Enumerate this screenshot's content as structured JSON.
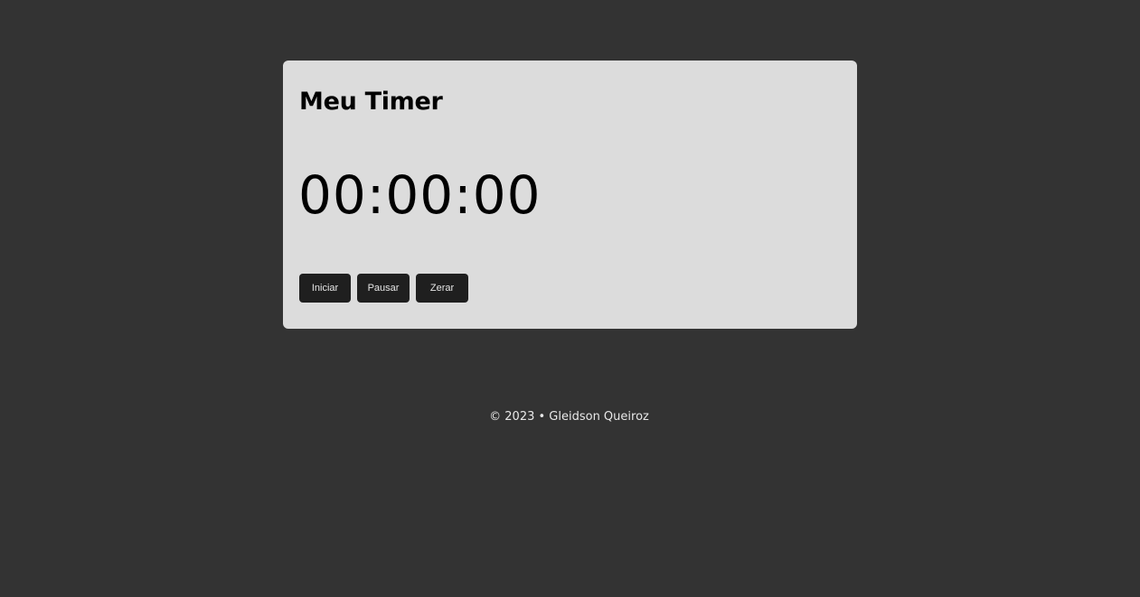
{
  "timer": {
    "title": "Meu Timer",
    "display": "00:00:00",
    "buttons": {
      "start": "Iniciar",
      "pause": "Pausar",
      "reset": "Zerar"
    }
  },
  "footer": {
    "text": "© 2023 • Gleidson Queiroz"
  },
  "colors": {
    "page_background": "#333333",
    "card_background": "#dcdcdc",
    "button_background": "#1f1f1f",
    "button_text": "#e6e6e6",
    "footer_text": "#e8e8e8"
  }
}
